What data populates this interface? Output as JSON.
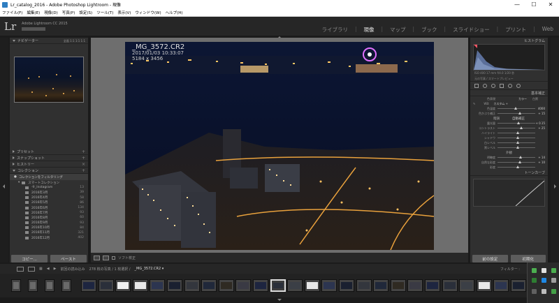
{
  "window": {
    "title": "Lr_catalog_2016 - Adobe Photoshop Lightroom - 現像",
    "min_symbol": "—",
    "max_symbol": "☐",
    "close_symbol": "✕"
  },
  "menu": [
    "ファイル(F)",
    "編集(E)",
    "現像(D)",
    "写真(P)",
    "設定(S)",
    "ツール(T)",
    "表示(V)",
    "ウィンドウ(W)",
    "ヘルプ(H)"
  ],
  "header": {
    "logo": "Lr",
    "brand": "Adobe Lightroom CC 2015",
    "modules": [
      "ライブラリ",
      "現像",
      "マップ",
      "ブック",
      "スライドショー",
      "プリント",
      "Web"
    ],
    "active_module": "現像"
  },
  "left_panel": {
    "navigator_label": "ナビゲーター",
    "navigator_options": "全画 1:1 1:1 1:1",
    "sections": [
      "プリセット",
      "スナップショット",
      "ヒストリー",
      "コレクション"
    ],
    "filter_label": "コレクションをフィルタリング",
    "smart_collection": "スマートコレクション",
    "collections": [
      {
        "name": "-fr_Instagram",
        "count": "13"
      },
      {
        "name": "2016年3月",
        "count": "39"
      },
      {
        "name": "2016年4月",
        "count": "58"
      },
      {
        "name": "2016年5月",
        "count": "86"
      },
      {
        "name": "2016年6月",
        "count": "134"
      },
      {
        "name": "2016年7月",
        "count": "93"
      },
      {
        "name": "2016年8月",
        "count": "60"
      },
      {
        "name": "2016年9月",
        "count": "93"
      },
      {
        "name": "2016年10月",
        "count": "84"
      },
      {
        "name": "2016年11月",
        "count": "321"
      },
      {
        "name": "2016年12月",
        "count": "402"
      }
    ],
    "copy_button": "コピー...",
    "paste_button": "ペースト"
  },
  "photo": {
    "filename": "_MG_3572.CR2",
    "datetime": "2017/01/03 10:33:07",
    "dimensions": "5184 x 3456"
  },
  "toolbar": {
    "softproof_label": "ソフト校正"
  },
  "right_panel": {
    "histogram_label": "ヒストグラム",
    "histogram_info": "ISO 400   17 mm   f/4.0   1/20 秒",
    "original_label": "元の写真 / スマートプレビュー",
    "basic_label": "基本補正",
    "treatment_label": "色表現",
    "treatment_color": "カラー",
    "treatment_bw": "白黒",
    "wb_label": "WB:",
    "wb_value": "カスタム ÷",
    "tone_label": "階調",
    "auto_label": "自動補正",
    "presence_label": "外観",
    "sliders_wb": [
      {
        "label": "色温度",
        "value": "4000",
        "pos": 0.45
      },
      {
        "label": "色かぶり補正",
        "value": "+ 15",
        "pos": 0.55
      }
    ],
    "sliders_tone": [
      {
        "label": "露光量",
        "value": "+ 0.15",
        "pos": 0.52
      },
      {
        "label": "コントラスト",
        "value": "+ 25",
        "pos": 0.6
      },
      {
        "label": "ハイライト",
        "value": "",
        "pos": 0.5
      },
      {
        "label": "シャドウ",
        "value": "",
        "pos": 0.5
      },
      {
        "label": "白レベル",
        "value": "",
        "pos": 0.5
      },
      {
        "label": "黒レベル",
        "value": "",
        "pos": 0.5
      }
    ],
    "sliders_presence": [
      {
        "label": "明瞭度",
        "value": "+ 14",
        "pos": 0.57
      },
      {
        "label": "自然な彩度",
        "value": "+ 10",
        "pos": 0.55
      },
      {
        "label": "彩度",
        "value": "",
        "pos": 0.5
      }
    ],
    "tonecurve_label": "トーンカーブ",
    "prev_button": "前の設定",
    "reset_button": "初期化"
  },
  "filmbar": {
    "source": "前回の読み込み",
    "count_text": "278 枚の写真 / 1 枚選択 /",
    "selected_name": "_MG_3572.CR2 ▾",
    "filter_label": "フィルター :"
  },
  "colors": {
    "accent": "#e8e8e8",
    "panel": "#303030",
    "background": "#1b1b1b"
  }
}
